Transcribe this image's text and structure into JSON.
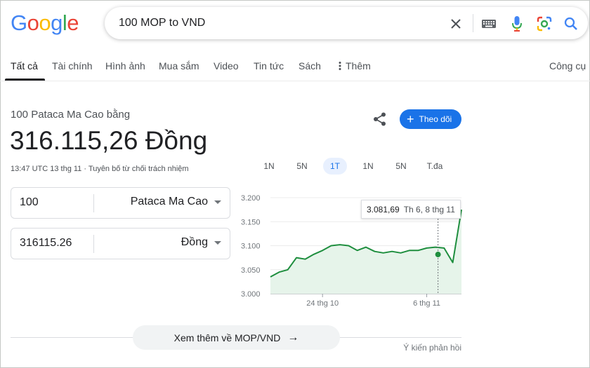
{
  "logo": {
    "letters": [
      "G",
      "o",
      "o",
      "g",
      "l",
      "e"
    ],
    "colors": [
      "#4285f4",
      "#ea4335",
      "#fbbc05",
      "#4285f4",
      "#34a853",
      "#ea4335"
    ]
  },
  "search": {
    "query": "100 MOP to VND"
  },
  "tabs": [
    {
      "label": "Tất cả"
    },
    {
      "label": "Tài chính"
    },
    {
      "label": "Hình ảnh"
    },
    {
      "label": "Mua sắm"
    },
    {
      "label": "Video"
    },
    {
      "label": "Tin tức"
    },
    {
      "label": "Sách"
    },
    {
      "label": "Thêm"
    }
  ],
  "tools_label": "Công cụ",
  "result": {
    "label": "100 Pataca Ma Cao bằng",
    "value": "316.115,26 Đồng",
    "time": "13:47 UTC 13 thg 11",
    "sep": " · ",
    "disclaimer": "Tuyên bố từ chối trách nhiệm"
  },
  "follow_label": "Theo dõi",
  "ranges": [
    "1N",
    "5N",
    "1T",
    "1N",
    "5N",
    "T.đa"
  ],
  "active_range": "1T",
  "converter": {
    "from_amount": "100",
    "from_currency": "Pataca Ma Cao",
    "to_amount": "316115.26",
    "to_currency": "Đồng"
  },
  "chart_data": {
    "type": "line",
    "y_ticks": [
      "3.200",
      "3.150",
      "3.100",
      "3.050",
      "3.000"
    ],
    "ylim": [
      3000,
      3200
    ],
    "x_ticks": [
      {
        "label": "24 thg 10",
        "x": 6
      },
      {
        "label": "6 thg 11",
        "x": 18
      }
    ],
    "xlim": [
      0,
      22
    ],
    "x": [
      0,
      1,
      2,
      3,
      4,
      5,
      6,
      7,
      8,
      9,
      10,
      11,
      12,
      13,
      14,
      15,
      16,
      17,
      18,
      19,
      20,
      21,
      22
    ],
    "values": [
      3035,
      3045,
      3050,
      3075,
      3072,
      3082,
      3090,
      3100,
      3102,
      3100,
      3090,
      3097,
      3088,
      3085,
      3088,
      3085,
      3090,
      3090,
      3095,
      3097,
      3095,
      3065,
      3175
    ],
    "line_color": "#1e8e3e",
    "fill_color": "#e6f4ea",
    "tooltip": {
      "value": "3.081,69",
      "date": "Th 6, 8 thg 11",
      "x": 19.3,
      "y": 3081.69
    }
  },
  "more_label": "Xem thêm về MOP/VND",
  "feedback_label": "Ý kiến phản hồi"
}
